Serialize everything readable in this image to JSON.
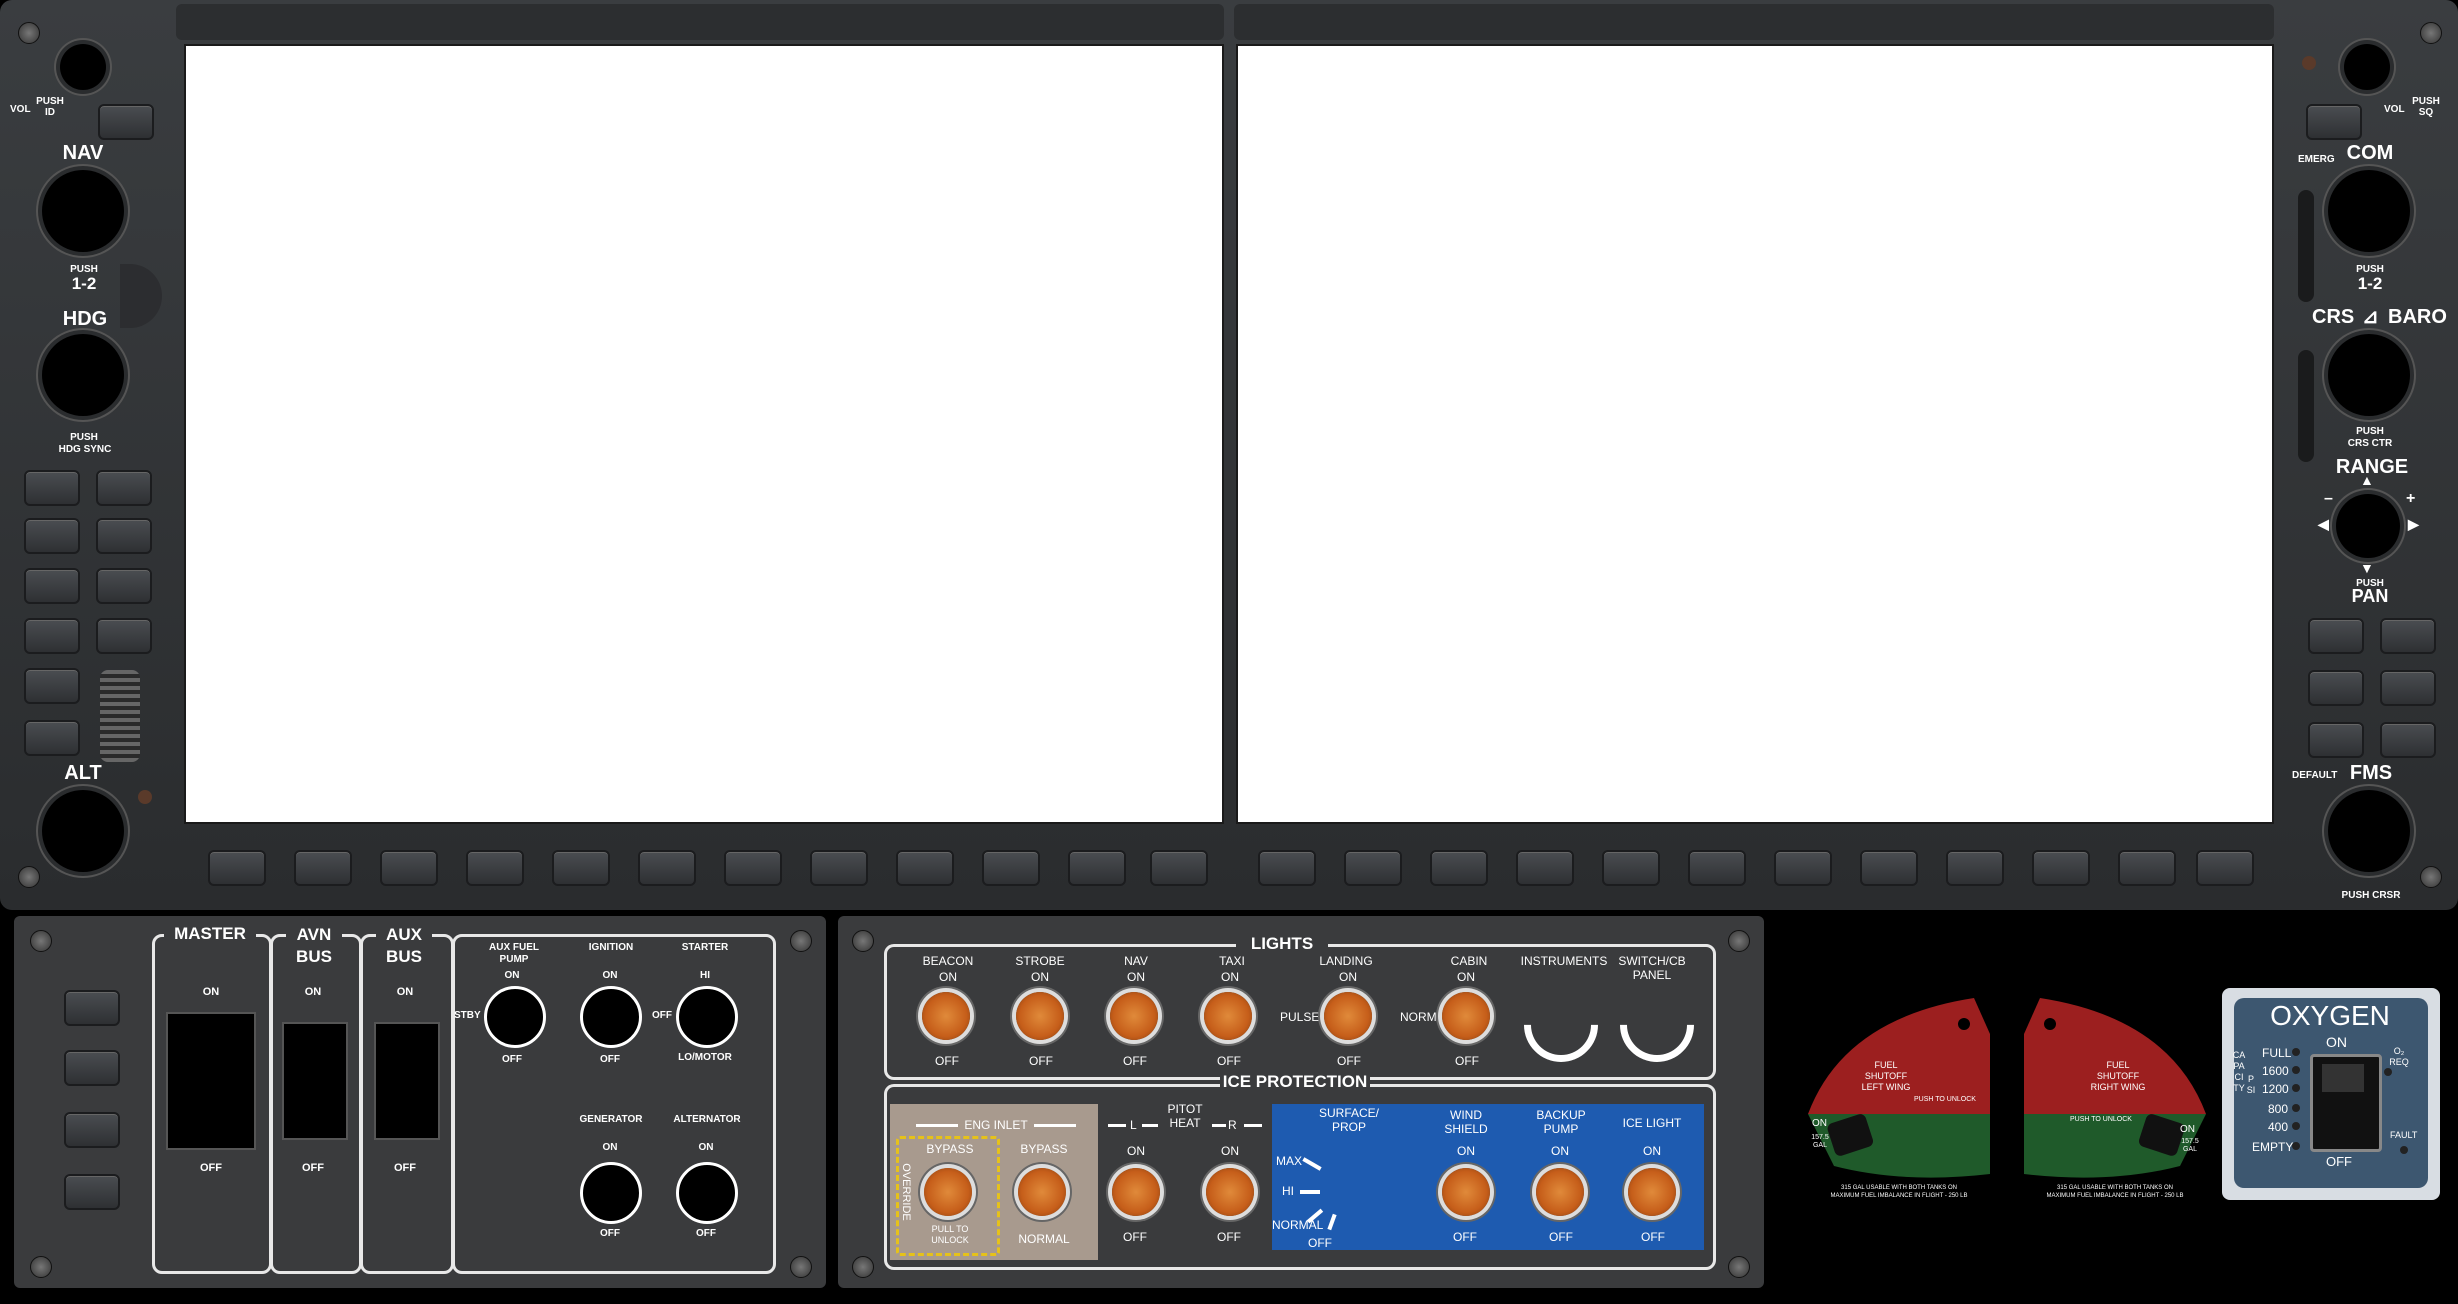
{
  "left_panel": {
    "vol": "VOL",
    "push_id": "PUSH\nID",
    "nav": "NAV",
    "nav_push": "PUSH",
    "nav_12": "1-2",
    "hdg": "HDG",
    "hdg_push": "PUSH",
    "hdg_sync": "HDG SYNC",
    "alt": "ALT"
  },
  "right_panel": {
    "vol": "VOL",
    "push_sq": "PUSH\nSQ",
    "emerg": "EMERG",
    "com": "COM",
    "com_push": "PUSH",
    "com_12": "1-2",
    "crs": "CRS",
    "baro": "BARO",
    "crs_push": "PUSH",
    "crs_ctr": "CRS CTR",
    "range": "RANGE",
    "minus": "–",
    "plus": "+",
    "pan_push": "PUSH",
    "pan": "PAN",
    "default": "DEFAULT",
    "fms": "FMS",
    "push_crsr": "PUSH CRSR"
  },
  "switch_panel": {
    "master": "MASTER",
    "avn_bus": "AVN\nBUS",
    "aux_bus": "AUX\nBUS",
    "on": "ON",
    "off": "OFF",
    "aux_fuel_pump": "AUX FUEL\nPUMP",
    "stby": "STBY",
    "ignition": "IGNITION",
    "starter": "STARTER",
    "hi": "HI",
    "lo_motor": "LO/MOTOR",
    "generator": "GENERATOR",
    "alternator": "ALTERNATOR"
  },
  "lights_panel": {
    "title": "LIGHTS",
    "beacon": "BEACON",
    "strobe": "STROBE",
    "nav": "NAV",
    "taxi": "TAXI",
    "landing": "LANDING",
    "pulse": "PULSE",
    "cabin": "CABIN",
    "norm": "NORM",
    "instruments": "INSTRUMENTS",
    "switch_cb": "SWITCH/CB\nPANEL",
    "on": "ON",
    "off": "OFF"
  },
  "ice_panel": {
    "title": "ICE PROTECTION",
    "eng_inlet": "ENG INLET",
    "bypass": "BYPASS",
    "override": "OVERRIDE",
    "pull_unlock": "PULL TO\nUNLOCK",
    "normal": "NORMAL",
    "pitot_heat": "PITOT\nHEAT",
    "l": "L",
    "r": "R",
    "surface_prop": "SURFACE/\nPROP",
    "max": "MAX",
    "hi": "HI",
    "normal2": "NORMAL",
    "off": "OFF",
    "windshield": "WIND\nSHIELD",
    "backup_pump": "BACKUP\nPUMP",
    "ice_light": "ICE LIGHT",
    "on": "ON"
  },
  "fuel_shutoff": {
    "left_title": "FUEL\nSHUTOFF\nLEFT WING",
    "right_title": "FUEL\nSHUTOFF\nRIGHT WING",
    "push_unlock": "PUSH TO UNLOCK",
    "on": "ON",
    "gal": "157.5\nGAL",
    "left_note": "315 GAL USABLE WITH BOTH TANKS ON\nMAXIMUM FUEL IMBALANCE IN FLIGHT - 250 LB",
    "right_note": "315 GAL USABLE WITH BOTH TANKS ON\nMAXIMUM FUEL IMBALANCE IN FLIGHT - 250 LB"
  },
  "oxygen": {
    "title": "OXYGEN",
    "on": "ON",
    "off": "OFF",
    "capacity": "CAPACITY",
    "psi": "PSI",
    "full": "FULL",
    "p1600": "1600",
    "p1200": "1200",
    "p800": "800",
    "p400": "400",
    "empty": "EMPTY",
    "o2req": "O₂\nREQ",
    "fault": "FAULT"
  },
  "colors": {
    "lamp": "#c65e1a",
    "ice_blue": "#1e5bb0",
    "fuel_red": "#9c1f1f",
    "fuel_green": "#1f5a2a"
  }
}
